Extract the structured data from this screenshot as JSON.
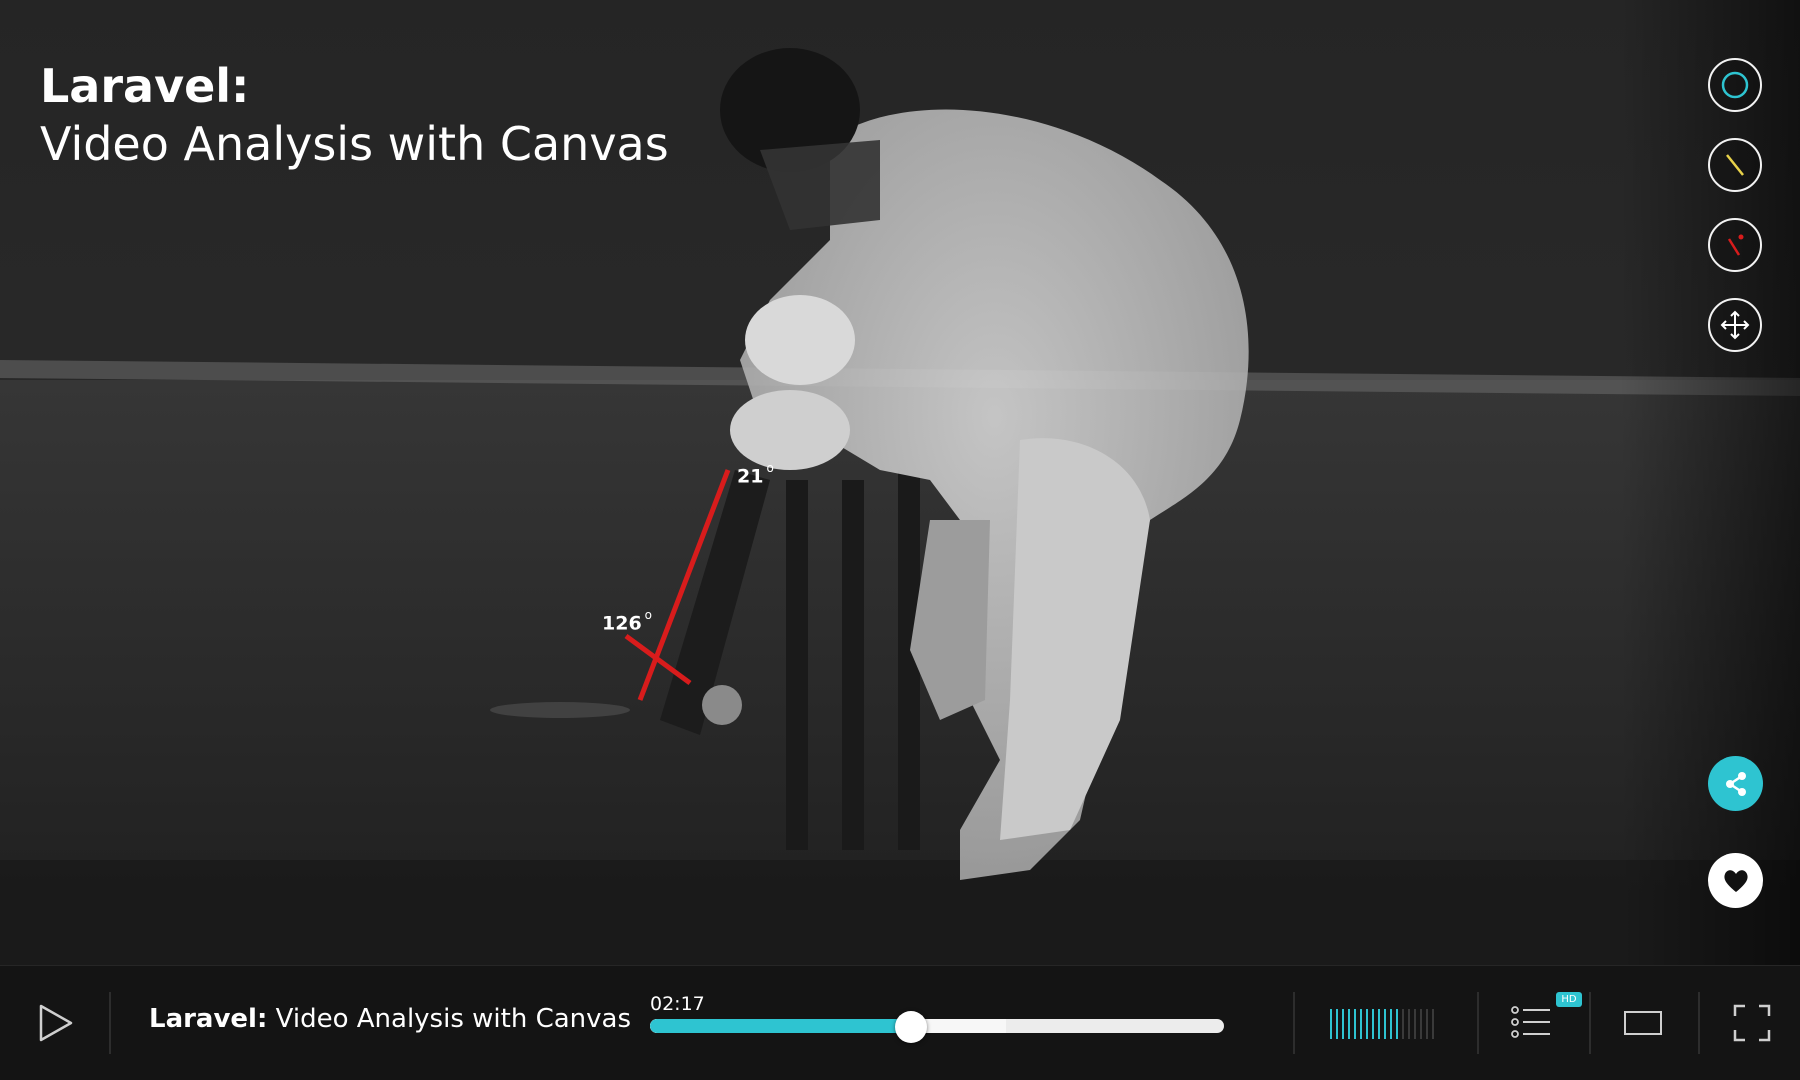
{
  "video": {
    "title_bold": "Laravel:",
    "title_rest": "Video Analysis with Canvas",
    "angle_top": "21",
    "angle_bottom": "126",
    "degree_symbol": "o"
  },
  "tools": [
    {
      "name": "circle-tool",
      "icon": "circle-icon",
      "color": "#2ec4d1"
    },
    {
      "name": "line-tool",
      "icon": "line-icon",
      "color": "#e8d24a"
    },
    {
      "name": "angle-tool",
      "icon": "angle-icon",
      "color": "#d81c1c"
    },
    {
      "name": "move-tool",
      "icon": "move-icon",
      "color": "#ffffff"
    }
  ],
  "actions": {
    "share_icon": "share-icon",
    "favorite_icon": "heart-icon"
  },
  "player": {
    "title_bold": "Laravel:",
    "title_rest": " Video Analysis with Canvas",
    "current_time": "02:17",
    "progress": 0.455,
    "buffered": 0.62,
    "volume_level": 0.68,
    "hd_label": "HD"
  },
  "colors": {
    "accent": "#2ec4d1",
    "annotation_red": "#d81c1c"
  }
}
